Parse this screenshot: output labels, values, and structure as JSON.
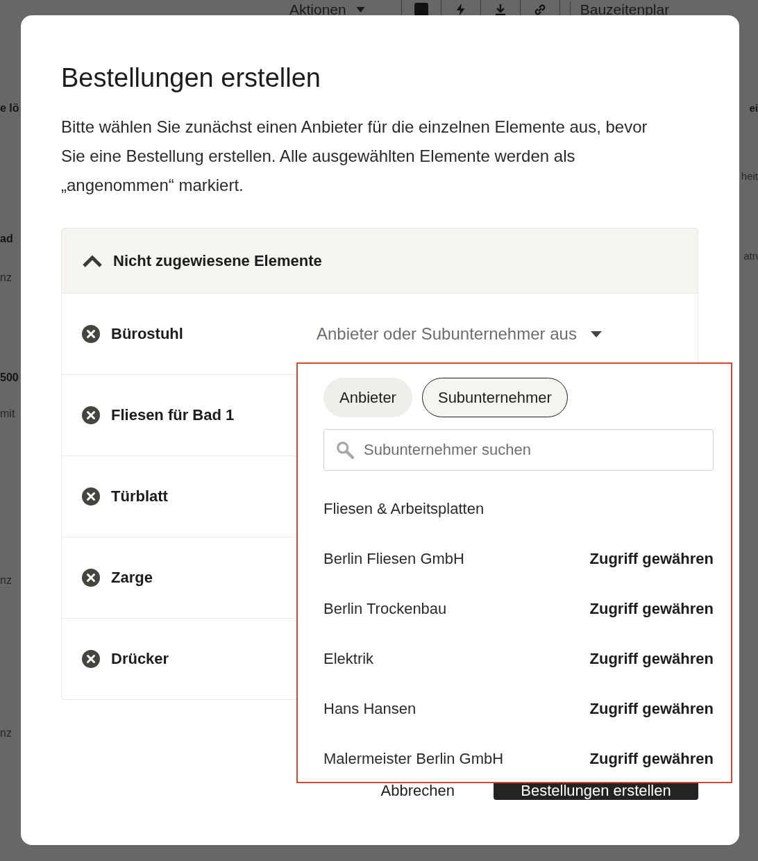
{
  "background": {
    "toolbar": {
      "actions_label": "Aktionen",
      "right_label": "Bauzeitenplar"
    },
    "left_fragments": [
      {
        "text": "e lö",
        "kind": "bold"
      },
      {
        "text": "ad",
        "kind": "bold"
      },
      {
        "text": "nz",
        "kind": "plain"
      },
      {
        "text": "500",
        "kind": "bold"
      },
      {
        "text": "mit",
        "kind": "plain"
      },
      {
        "text": "nz",
        "kind": "plain"
      },
      {
        "text": "nz",
        "kind": "plain"
      }
    ],
    "right_fragments": [
      {
        "text": "ei",
        "kind": "bold"
      },
      {
        "text": "heit",
        "kind": "plain"
      },
      {
        "text": "atn",
        "kind": "plain"
      }
    ]
  },
  "dialog": {
    "title": "Bestellungen erstellen",
    "description": "Bitte wählen Sie zunächst einen Anbieter für die einzelnen Elemente aus, bevor Sie eine Bestellung erstellen. Alle ausgewählten Elemente werden als „angenommen“ markiert.",
    "section": {
      "title": "Nicht zugewiesene Elemente",
      "expanded": true,
      "items": [
        {
          "name": "Bürostuhl",
          "select_placeholder": "Anbieter oder Subunternehmer aus"
        },
        {
          "name": "Fliesen für Bad 1"
        },
        {
          "name": "Türblatt"
        },
        {
          "name": "Zarge"
        },
        {
          "name": "Drücker"
        }
      ]
    },
    "dropdown": {
      "tabs": [
        {
          "label": "Anbieter",
          "selected": false
        },
        {
          "label": "Subunternehmer",
          "selected": true
        }
      ],
      "search": {
        "placeholder": "Subunternehmer suchen"
      },
      "group": "Fliesen & Arbeitsplatten",
      "entries": [
        {
          "name": "Berlin Fliesen GmbH",
          "action": "Zugriff gewähren"
        },
        {
          "name": "Berlin Trockenbau",
          "action": "Zugriff gewähren"
        },
        {
          "name": "Elektrik",
          "action": "Zugriff gewähren"
        },
        {
          "name": "Hans Hansen",
          "action": "Zugriff gewähren"
        },
        {
          "name": "Malermeister Berlin GmbH",
          "action": "Zugriff gewähren"
        }
      ]
    },
    "buttons": [
      {
        "label": "Abbrechen",
        "kind": "secondary"
      },
      {
        "label": "Bestellungen erstellen",
        "kind": "primary"
      }
    ]
  }
}
